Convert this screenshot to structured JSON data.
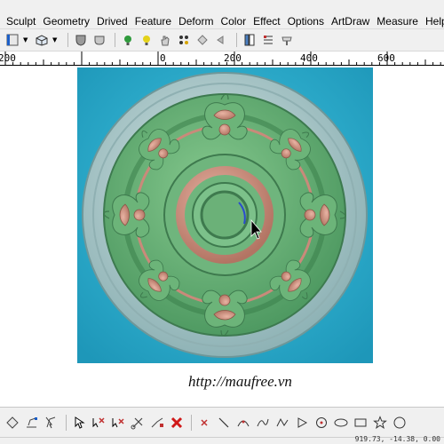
{
  "menu": [
    "Sculpt",
    "Geometry",
    "Drived",
    "Feature",
    "Deform",
    "Color",
    "Effect",
    "Options",
    "ArtDraw",
    "Measure",
    "Help"
  ],
  "ruler": {
    "labels": [
      "200",
      "0",
      "200",
      "400",
      "600"
    ]
  },
  "canvas": {
    "watermark": "http://maufree.vn"
  },
  "status": {
    "coords": "919.73, -14.38, 0.00"
  },
  "colors": {
    "background_cyan": "#2fb3d2",
    "relief_green": "#5fa870",
    "relief_pink": "#c98a7a",
    "rim_gray": "#a8c2c4"
  },
  "toolbar_icons": [
    "view-icon",
    "dropdown-icon",
    "box-view-icon",
    "dropdown-icon",
    "shield-icon",
    "material-icon",
    "light-green-icon",
    "light-yellow-icon",
    "hand-icon",
    "dots-icon",
    "diamond-icon",
    "arrow-icon",
    "layers-icon",
    "grid-icon",
    "brush-icon"
  ],
  "bottom_icons": [
    "select-node-icon",
    "edit-node-icon",
    "select-arrow-icon",
    "cut-icon",
    "cross-select-icon",
    "pen-node-icon",
    "scissors-icon",
    "delete-icon",
    "point-icon",
    "line-icon",
    "arc-icon",
    "curve-icon",
    "triangle-icon",
    "circle-target-icon",
    "ellipse-icon",
    "rectangle-icon",
    "star-icon",
    "circle-icon"
  ]
}
